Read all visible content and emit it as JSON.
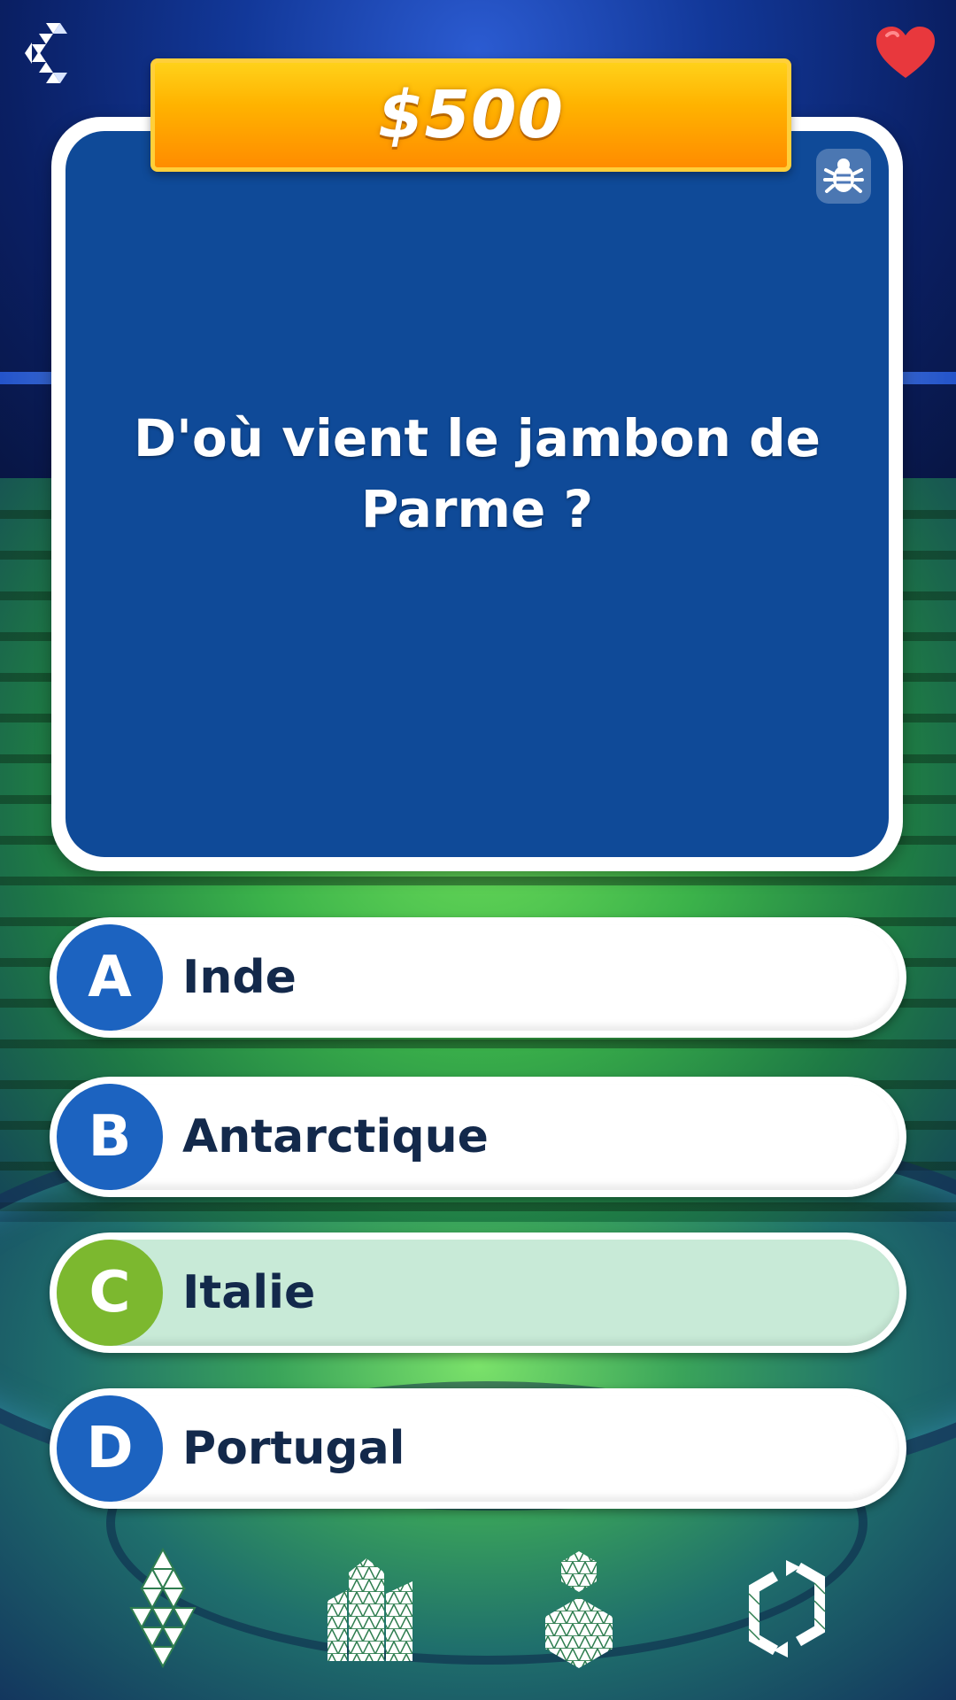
{
  "prize": {
    "amount": "$500"
  },
  "question": {
    "text": "D'où vient le jambon de Parme ?"
  },
  "answers": [
    {
      "letter": "A",
      "text": "Inde",
      "selected": false
    },
    {
      "letter": "B",
      "text": "Antarctique",
      "selected": false
    },
    {
      "letter": "C",
      "text": "Italie",
      "selected": true
    },
    {
      "letter": "D",
      "text": "Portugal",
      "selected": false
    }
  ],
  "icons": {
    "back": "back-chevron-icon",
    "heart": "heart-icon",
    "bug": "bug-report-icon",
    "lifelines": [
      "fifty-fifty-lifeline-icon",
      "audience-poll-lifeline-icon",
      "phone-friend-lifeline-icon",
      "switch-question-lifeline-icon"
    ]
  },
  "colors": {
    "card_blue": "#0f4a98",
    "prize_orange": "#ff9f00",
    "answer_letter_blue": "#1c63c0",
    "selected_green": "#7cb82f",
    "selected_fill": "#c8ead7",
    "heart_red": "#e8383d"
  }
}
